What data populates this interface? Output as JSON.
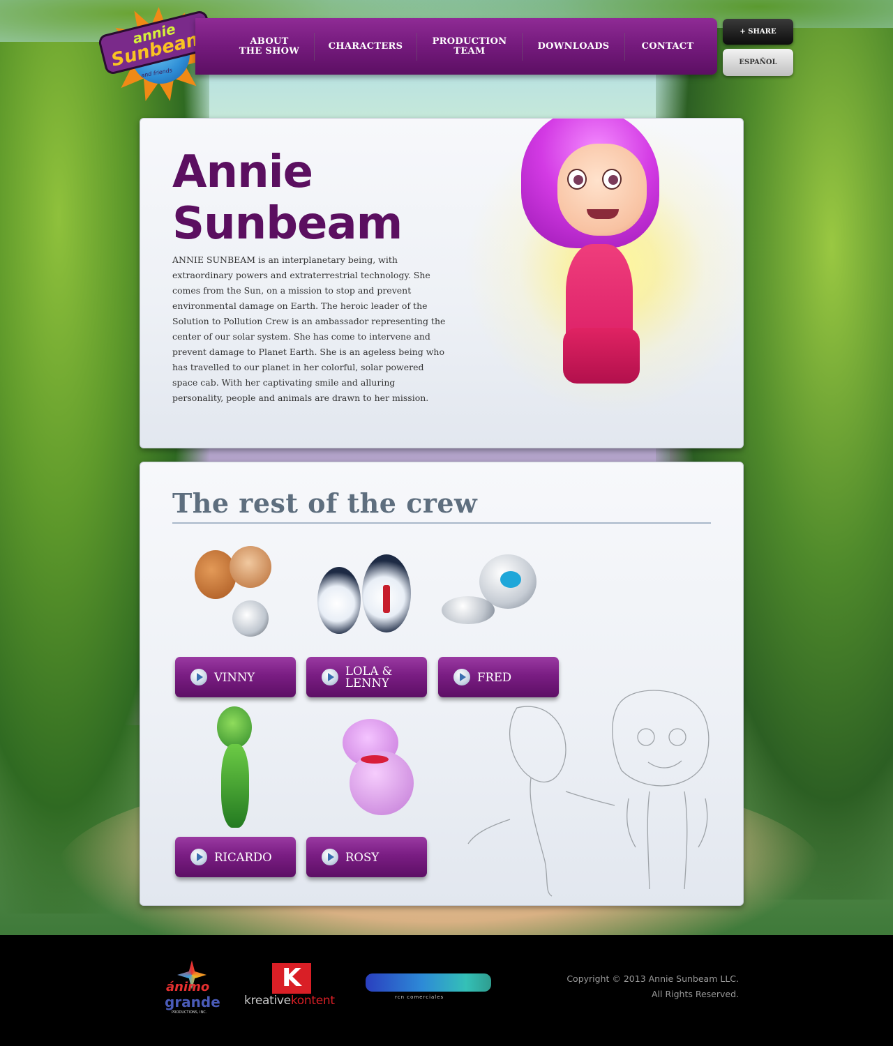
{
  "logo": {
    "line1": "annie",
    "line2": "Sunbeam",
    "line3": "and friends"
  },
  "nav": {
    "items": [
      {
        "label": "ABOUT\nTHE SHOW"
      },
      {
        "label": "CHARACTERS"
      },
      {
        "label": "PRODUCTION\nTEAM"
      },
      {
        "label": "DOWNLOADS"
      },
      {
        "label": "CONTACT"
      }
    ]
  },
  "header_buttons": {
    "share": "+ SHARE",
    "language": "ESPAÑOL"
  },
  "hero": {
    "name_line1": "Annie",
    "name_line2": "Sunbeam",
    "description": "ANNIE SUNBEAM is an interplanetary being, with extraordinary powers and extraterrestrial technology. She comes from the Sun, on a mission to stop and prevent environmental damage on Earth. The heroic leader of the Solution to Pollution Crew is an ambassador representing the center of our solar system. She has come to intervene and prevent damage to Planet Earth. She is an ageless being who has travelled to our planet in her colorful, solar powered space cab. With her captivating smile and alluring personality, people and animals are drawn to her mission."
  },
  "crew": {
    "title": "The rest of the crew",
    "characters": [
      {
        "label": "VINNY"
      },
      {
        "label": "LOLA &\nLENNY"
      },
      {
        "label": "FRED"
      },
      {
        "label": "RICARDO"
      },
      {
        "label": "ROSY"
      }
    ]
  },
  "footer": {
    "partners": {
      "animo": {
        "line1": "ánimo",
        "line2": "grande",
        "line3": "PRODUCTIONS, INC."
      },
      "kreative": {
        "mark": "K",
        "prefix": "kreative",
        "suffix": "kontent"
      },
      "rcn": {
        "tagline": "rcn comerciales"
      }
    },
    "copyright_line1": "Copyright © 2013 Annie Sunbeam LLC.",
    "copyright_line2": "All Rights Reserved."
  },
  "colors": {
    "nav_purple": "#741a7c",
    "title_purple": "#5b0f60",
    "crew_title_gray": "#5e6e7e",
    "accent_pink": "#d33ae4"
  }
}
